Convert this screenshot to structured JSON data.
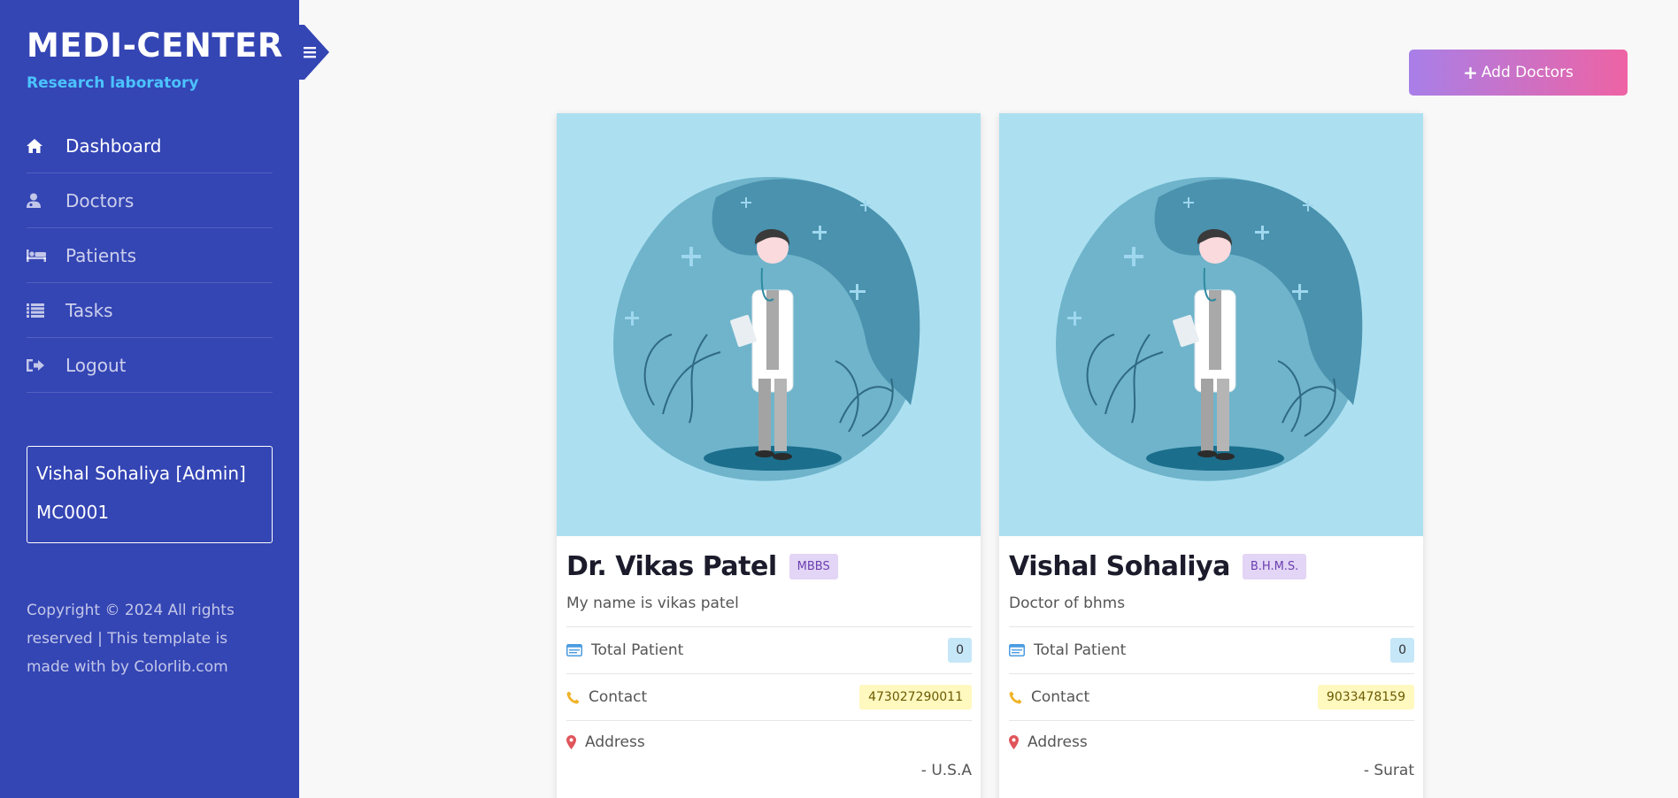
{
  "sidebar": {
    "brand": "MEDI-CENTER",
    "brand_sub": "Research laboratory",
    "menu": [
      {
        "label": "Dashboard",
        "icon": "home-icon"
      },
      {
        "label": "Doctors",
        "icon": "user-md-icon"
      },
      {
        "label": "Patients",
        "icon": "bed-icon"
      },
      {
        "label": "Tasks",
        "icon": "list-icon"
      },
      {
        "label": "Logout",
        "icon": "sign-out-icon"
      }
    ],
    "user": {
      "name": "Vishal Sohaliya [Admin]",
      "id": "MC0001"
    },
    "copyright": "Copyright © 2024 All rights reserved | This template is made with by Colorlib.com"
  },
  "header": {
    "add_button": "Add Doctors",
    "add_icon": "+"
  },
  "labels": {
    "total_patient": "Total Patient",
    "contact": "Contact",
    "address": "Address"
  },
  "doctors": [
    {
      "name": "Dr. Vikas Patel",
      "degree": "MBBS",
      "description": "My name is vikas patel",
      "total_patient": "0",
      "contact": "473027290011",
      "address": "- U.S.A"
    },
    {
      "name": "Vishal Sohaliya",
      "degree": "B.H.M.S.",
      "description": "Doctor of bhms",
      "total_patient": "0",
      "contact": "9033478159",
      "address": "- Surat"
    }
  ],
  "colors": {
    "sidebar": "#3445b4",
    "brand_sub": "#4bc3ff",
    "card_image_bg": "#ace0f1",
    "button_from": "#a87fe8",
    "button_to": "#ee63a4"
  }
}
